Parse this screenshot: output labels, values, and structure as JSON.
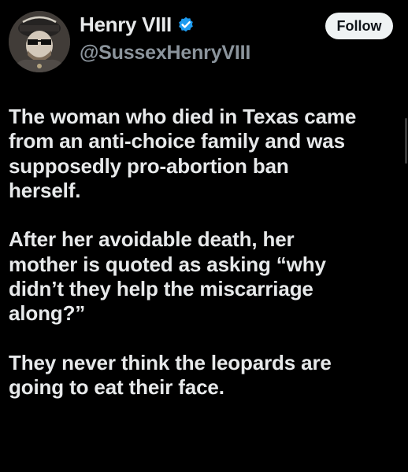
{
  "tweet": {
    "author": {
      "display_name": "Henry VIII",
      "handle": "@SussexHenryVIII",
      "verified_icon": "verified-badge-icon",
      "avatar_icon": "avatar-henry-viii"
    },
    "follow_label": "Follow",
    "paragraphs": [
      "The woman who died in Texas came\nfrom an anti-choice family and was\nsupposedly pro-abortion ban\nherself.",
      "After her avoidable death, her\nmother is quoted as asking “why\ndidn’t they help the miscarriage\nalong?”",
      "They never think the leopards are\ngoing to eat their face."
    ]
  },
  "colors": {
    "background": "#000000",
    "text": "#e7e9ea",
    "secondary_text": "#8b949c",
    "verified_blue": "#1d9bf0",
    "follow_bg": "#eff3f4"
  }
}
